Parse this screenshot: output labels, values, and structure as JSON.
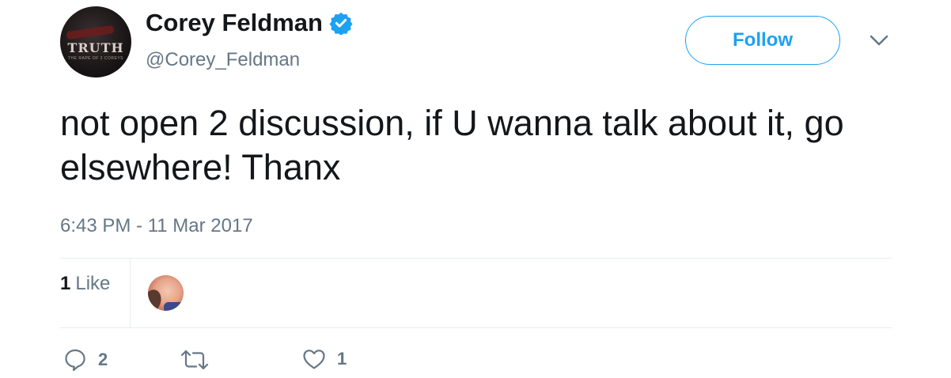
{
  "author": {
    "name": "Corey Feldman",
    "handle": "@Corey_Feldman",
    "avatar_logo_text": "TRUTH",
    "avatar_logo_subtext": "THE RAPE OF 2 COREYS",
    "verified_icon": "verified-badge-icon"
  },
  "header": {
    "follow_label": "Follow",
    "menu_icon": "chevron-down-icon"
  },
  "tweet": {
    "text": "not open 2 discussion, if U wanna talk about it, go elsewhere! Thanx",
    "timestamp": "6:43 PM - 11 Mar 2017"
  },
  "stats": {
    "likes_count": "1",
    "likes_label": "Like"
  },
  "actions": {
    "reply": {
      "icon": "reply-icon",
      "count": "2"
    },
    "retweet": {
      "icon": "retweet-icon",
      "count": ""
    },
    "like": {
      "icon": "heart-icon",
      "count": "1"
    }
  },
  "colors": {
    "accent": "#1da1f2",
    "secondary_text": "#657786",
    "divider": "#e6ecf0"
  }
}
